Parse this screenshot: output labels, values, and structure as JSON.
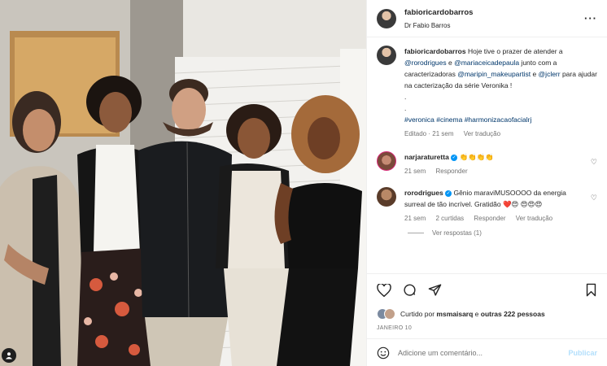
{
  "post": {
    "author": "fabioricardobarros",
    "author_subtitle": "Dr Fabio Barros",
    "more_icon": "more-horizontal-icon"
  },
  "caption": {
    "username": "fabioricardobarros",
    "text_1": "Hoje tive o prazer de atender a ",
    "mention_1": "@rorodrigues",
    "text_2": " e ",
    "mention_2": "@mariaceicadepaula",
    "text_3": " junto com a caracterizadoras ",
    "mention_3": "@maripin_makeupartist",
    "text_4": " e ",
    "mention_4": "@jclerr",
    "text_5": " para ajudar na cacterização da série Veronika !",
    "dot_1": ".",
    "dot_2": ".",
    "hashtags": "#veronica #cinema #harmonizacaofacialrj",
    "edited": "Editado · 21 sem",
    "translate": "Ver tradução"
  },
  "comments": [
    {
      "username": "narjaraturetta",
      "verified": true,
      "text": "👏👏👏👏",
      "time": "21 sem",
      "reply": "Responder"
    },
    {
      "username": "rorodrigues",
      "verified": true,
      "text": "Gênio maraviMUSOOOO da energia surreal de tão incrível. Gratidão ❤️😍 😍😍😍",
      "time": "21 sem",
      "likes": "2 curtidas",
      "reply": "Responder",
      "translate": "Ver tradução",
      "view_replies": "Ver respostas (1)"
    }
  ],
  "likes": {
    "prefix": "Curtido por ",
    "user": "msmaisarq",
    "middle": " e ",
    "others": "outras 222 pessoas"
  },
  "date": "JANEIRO 10",
  "comment_input": {
    "placeholder": "Adicione um comentário...",
    "publish": "Publicar"
  },
  "colors": {
    "link": "#00376b",
    "verified": "#0095f6",
    "publish_disabled": "#b2dffc"
  }
}
